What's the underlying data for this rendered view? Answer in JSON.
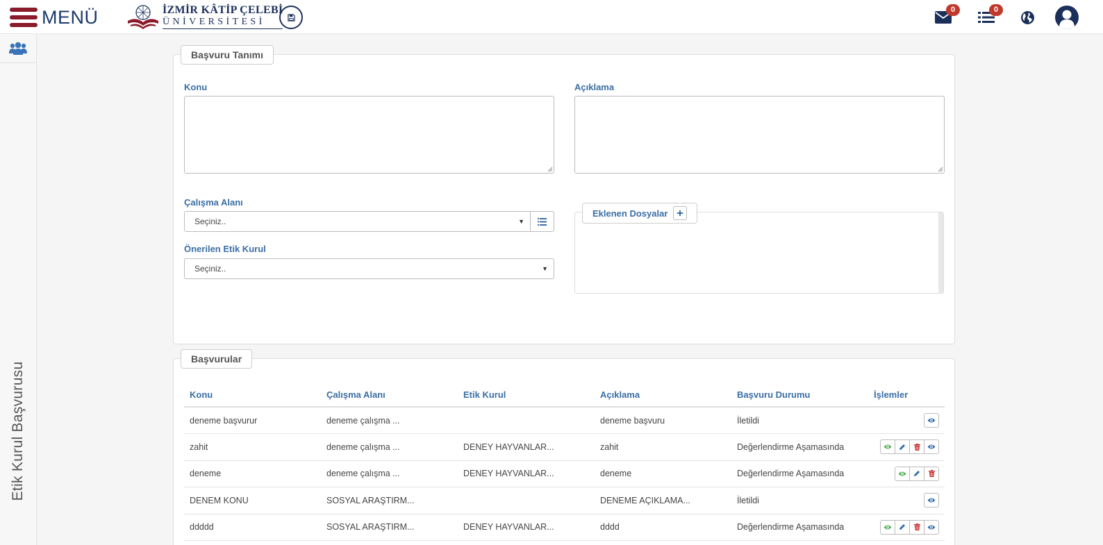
{
  "header": {
    "menu_label": "MENÜ",
    "logo_line1": "İZMİR KÂTİP ÇELEBİ",
    "logo_line2": "ÜNİVERSİTESİ",
    "messages_count": "0",
    "tasks_count": "0",
    "colors": {
      "brand_red": "#8b1a2b",
      "brand_navy": "#1b2f5b",
      "badge": "#c0392b"
    }
  },
  "sidebar": {
    "vertical_title": "Etik Kurul Başvurusu",
    "top_icon": "users-icon"
  },
  "form": {
    "legend": "Başvuru Tanımı",
    "konu_label": "Konu",
    "aciklama_label": "Açıklama",
    "konu_value": "",
    "aciklama_value": "",
    "calisma_alani_label": "Çalışma Alanı",
    "calisma_alani_selected": "Seçiniz..",
    "onerilen_kurul_label": "Önerilen Etik Kurul",
    "onerilen_kurul_selected": "Seçiniz..",
    "files_legend": "Eklenen Dosyalar"
  },
  "applications": {
    "legend": "Başvurular",
    "columns": [
      "Konu",
      "Çalışma Alanı",
      "Etik Kurul",
      "Açıklama",
      "Başvuru Durumu",
      "İşlemler"
    ],
    "rows": [
      {
        "konu": "deneme başvurur",
        "alan": "deneme çalışma ...",
        "kurul": "",
        "aciklama": "deneme başvuru",
        "durum": "İletildi",
        "actions": [
          "view"
        ]
      },
      {
        "konu": "zahit",
        "alan": "deneme çalışma ...",
        "kurul": "DENEY HAYVANLAR...",
        "aciklama": "zahit",
        "durum": "Değerlendirme Aşamasında",
        "actions": [
          "view-green",
          "edit",
          "delete",
          "view"
        ]
      },
      {
        "konu": "deneme",
        "alan": "deneme çalışma ...",
        "kurul": "DENEY HAYVANLAR...",
        "aciklama": "deneme",
        "durum": "Değerlendirme Aşamasında",
        "actions": [
          "view-green",
          "edit",
          "delete"
        ]
      },
      {
        "konu": "DENEM KONU",
        "alan": "SOSYAL ARAŞTIRM...",
        "kurul": "",
        "aciklama": "DENEME AÇIKLAMA...",
        "durum": "İletildi",
        "actions": [
          "view"
        ]
      },
      {
        "konu": "ddddd",
        "alan": "SOSYAL ARAŞTIRM...",
        "kurul": "DENEY HAYVANLAR...",
        "aciklama": "dddd",
        "durum": "Değerlendirme Aşamasında",
        "actions": [
          "view-green",
          "edit",
          "delete",
          "view"
        ]
      }
    ]
  }
}
